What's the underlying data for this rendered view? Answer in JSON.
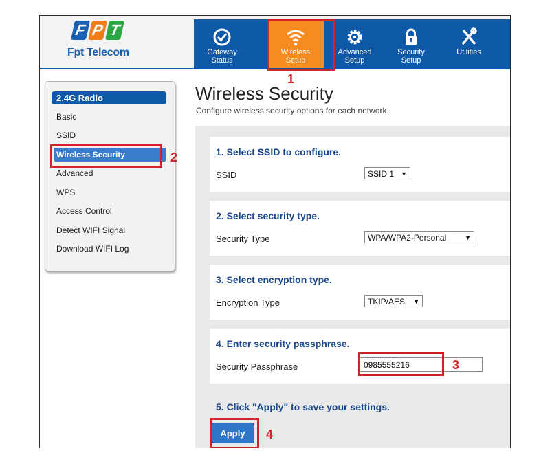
{
  "brand": {
    "logo_letters": [
      "F",
      "P",
      "T"
    ],
    "logo_name": "Fpt Telecom",
    "colors": {
      "blue": "#1a60b3",
      "orange": "#f07d1a",
      "green": "#2aa845"
    }
  },
  "nav": {
    "items": [
      {
        "label": "Gateway Status",
        "icon": "check-circle-icon"
      },
      {
        "label": "Wireless Setup",
        "icon": "wifi-icon",
        "active": true
      },
      {
        "label": "Advanced Setup",
        "icon": "gear-icon"
      },
      {
        "label": "Security Setup",
        "icon": "lock-icon"
      },
      {
        "label": "Utilities",
        "icon": "tools-icon"
      }
    ],
    "colors": {
      "bar": "#0f5aa8",
      "active": "#f68b1f"
    }
  },
  "sidebar": {
    "header": "2.4G Radio",
    "items": [
      "Basic",
      "SSID",
      "Wireless Security",
      "Advanced",
      "WPS",
      "Access Control",
      "Detect WIFI Signal",
      "Download WIFI Log"
    ],
    "active": "Wireless Security"
  },
  "main": {
    "title": "Wireless Security",
    "subtitle": "Configure wireless security options for each network.",
    "sections": [
      {
        "title": "1. Select SSID to configure.",
        "label": "SSID",
        "value": "SSID 1"
      },
      {
        "title": "2. Select security type.",
        "label": "Security Type",
        "value": "WPA/WPA2-Personal"
      },
      {
        "title": "3. Select encryption type.",
        "label": "Encryption Type",
        "value": "TKIP/AES"
      },
      {
        "title": "4. Enter security passphrase.",
        "label": "Security Passphrase",
        "value": "0985555216"
      }
    ],
    "apply_note": "5. Click \"Apply\" to save your settings.",
    "apply_label": "Apply"
  },
  "annotations": {
    "steps": [
      "1",
      "2",
      "3",
      "4"
    ],
    "color": "#d0232a"
  }
}
